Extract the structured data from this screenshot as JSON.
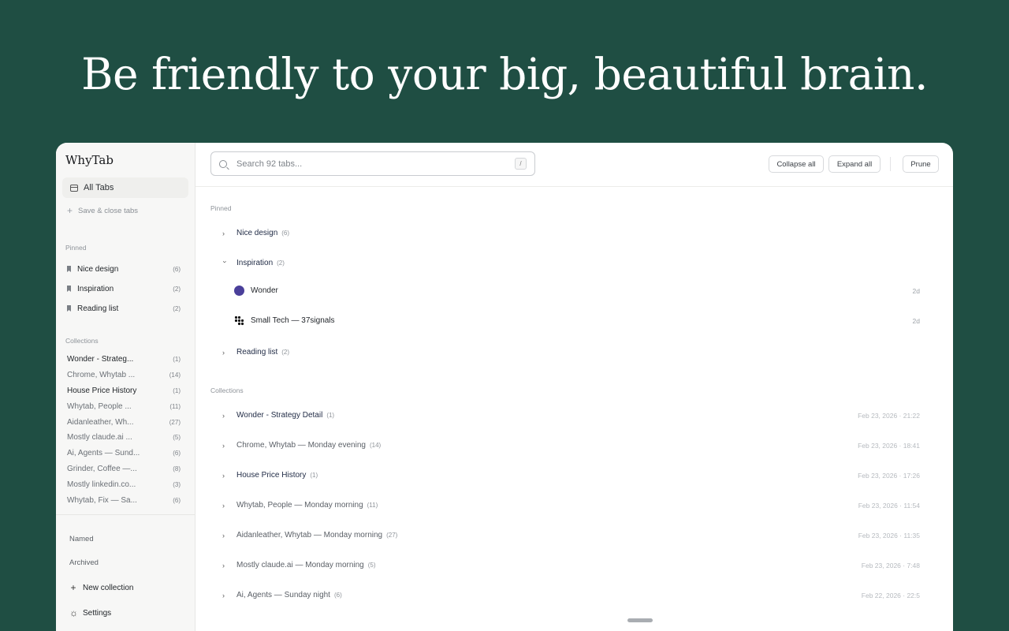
{
  "hero": {
    "headline": "Be friendly to your big, beautiful brain."
  },
  "sidebar": {
    "brand": "WhyTab",
    "all_tabs": "All Tabs",
    "save_close": "Save & close tabs",
    "pinned_label": "Pinned",
    "pinned": [
      {
        "name": "Nice design",
        "count": "(6)"
      },
      {
        "name": "Inspiration",
        "count": "(2)"
      },
      {
        "name": "Reading list",
        "count": "(2)"
      }
    ],
    "collections_label": "Collections",
    "collections": [
      {
        "name": "Wonder - Strateg...",
        "count": "(1)"
      },
      {
        "name": "Chrome, Whytab ...",
        "count": "(14)"
      },
      {
        "name": "House Price History",
        "count": "(1)"
      },
      {
        "name": "Whytab, People ...",
        "count": "(11)"
      },
      {
        "name": "Aidanleather, Wh...",
        "count": "(27)"
      },
      {
        "name": "Mostly claude.ai ...",
        "count": "(5)"
      },
      {
        "name": "Ai, Agents — Sund...",
        "count": "(6)"
      },
      {
        "name": "Grinder, Coffee —...",
        "count": "(8)"
      },
      {
        "name": "Mostly linkedin.co...",
        "count": "(3)"
      },
      {
        "name": "Whytab, Fix — Sa...",
        "count": "(6)"
      }
    ],
    "named": "Named",
    "archived": "Archived",
    "new_collection": "New collection",
    "settings": "Settings"
  },
  "toolbar": {
    "search_placeholder": "Search 92 tabs...",
    "shortcut": "/",
    "collapse_all": "Collapse all",
    "expand_all": "Expand all",
    "prune": "Prune"
  },
  "main": {
    "pinned_label": "Pinned",
    "pinned_groups": [
      {
        "name": "Nice design",
        "count": "(6)",
        "expanded": false
      },
      {
        "name": "Inspiration",
        "count": "(2)",
        "expanded": true
      },
      {
        "name": "Reading list",
        "count": "(2)",
        "expanded": false
      }
    ],
    "inspiration_tabs": [
      {
        "title": "Wonder",
        "age": "2d",
        "icon": "wonder-favicon"
      },
      {
        "title": "Small Tech — 37signals",
        "age": "2d",
        "icon": "37signals-favicon"
      }
    ],
    "collections_label": "Collections",
    "collections": [
      {
        "name": "Wonder - Strategy Detail",
        "count": "(1)",
        "date": "Feb 23, 2026 · 21:22"
      },
      {
        "name": "Chrome, Whytab — Monday evening",
        "count": "(14)",
        "date": "Feb 23, 2026 · 18:41"
      },
      {
        "name": "House Price History",
        "count": "(1)",
        "date": "Feb 23, 2026 · 17:26"
      },
      {
        "name": "Whytab, People — Monday morning",
        "count": "(11)",
        "date": "Feb 23, 2026 · 11:54"
      },
      {
        "name": "Aidanleather, Whytab — Monday morning",
        "count": "(27)",
        "date": "Feb 23, 2026 · 11:35"
      },
      {
        "name": "Mostly claude.ai — Monday morning",
        "count": "(5)",
        "date": "Feb 23, 2026 · 7:48"
      },
      {
        "name": "Ai, Agents — Sunday night",
        "count": "(6)",
        "date": "Feb 22, 2026 · 22:5"
      }
    ],
    "help": "?"
  },
  "colors": {
    "background": "#1f4e43",
    "accent_dot": "#4a3f9a"
  }
}
